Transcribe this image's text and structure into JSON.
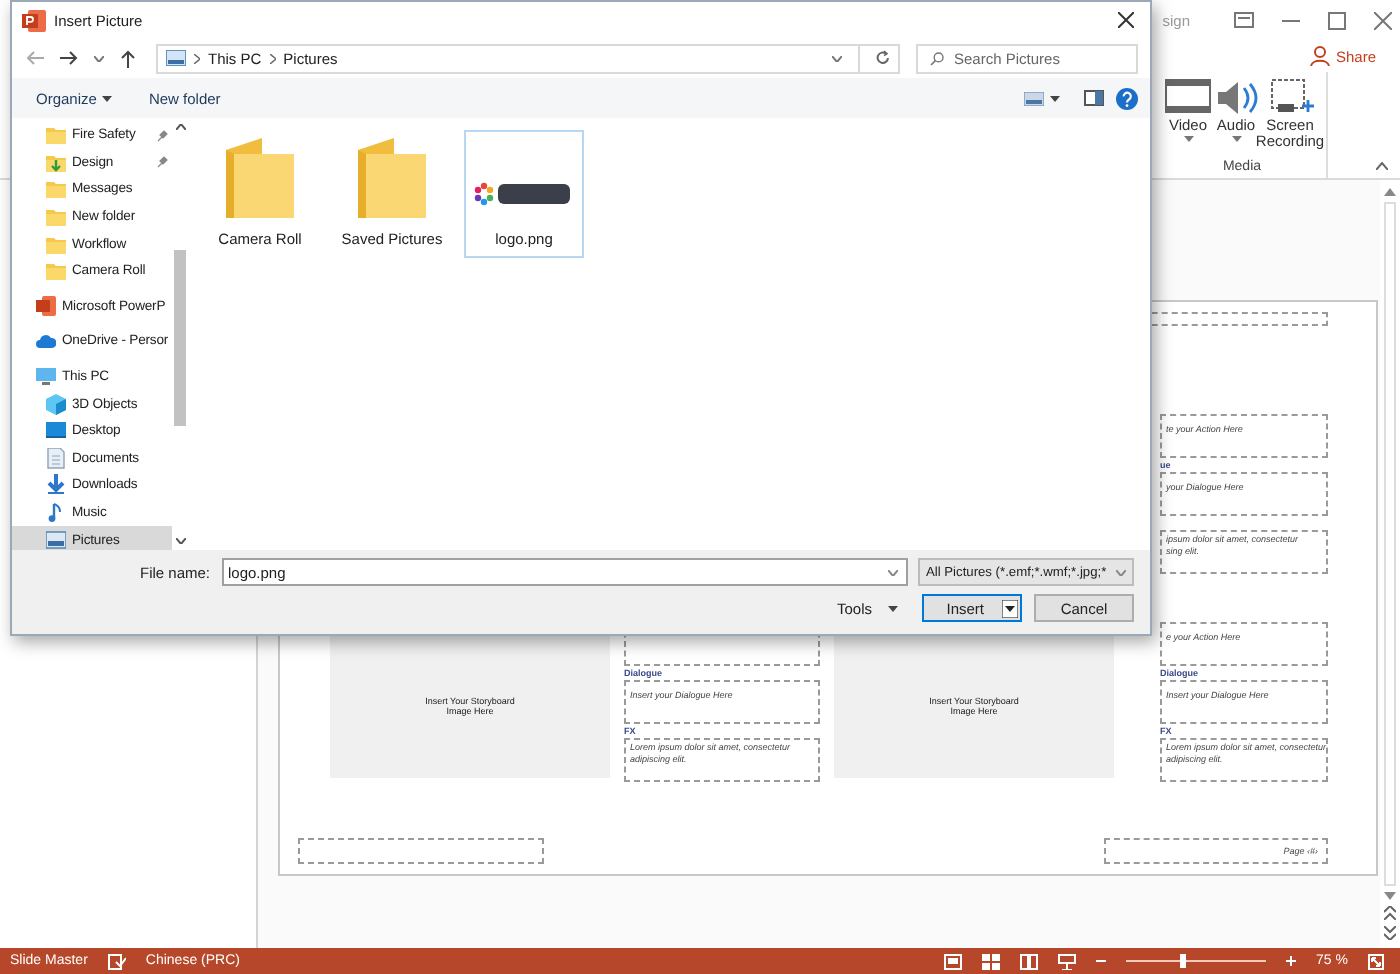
{
  "app": {
    "title_fragment": "sign",
    "share": "Share",
    "ribbon": {
      "buttons": [
        {
          "kind": "video",
          "label": "Video",
          "has_menu": true
        },
        {
          "kind": "audio",
          "label": "Audio",
          "has_menu": true
        },
        {
          "kind": "screen_recording",
          "label": "Screen Recording",
          "has_menu": false
        }
      ],
      "group": "Media"
    }
  },
  "dialog": {
    "title": "Insert Picture",
    "path": [
      "This PC",
      "Pictures"
    ],
    "search_placeholder": "Search Pictures",
    "toolbar": [
      "Organize",
      "New folder"
    ],
    "sidebar": [
      {
        "kind": "quick_access",
        "items": [
          {
            "label": "Fire Safety",
            "kind": "folder",
            "pinned": true,
            "selected": false
          },
          {
            "label": "Design",
            "kind": "download_folder",
            "pinned": true,
            "selected": false
          },
          {
            "label": "Messages",
            "kind": "folder",
            "pinned": false,
            "selected": false
          },
          {
            "label": "New folder",
            "kind": "folder",
            "pinned": false,
            "selected": false
          },
          {
            "label": "Workflow",
            "kind": "folder",
            "pinned": false,
            "selected": false
          },
          {
            "label": "Camera Roll",
            "kind": "folder",
            "pinned": false,
            "selected": false
          }
        ]
      },
      {
        "kind": "locations",
        "items": [
          {
            "label": "Microsoft PowerP",
            "kind": "powerpoint",
            "pinned": false,
            "selected": false
          }
        ]
      },
      {
        "kind": "locations",
        "items": [
          {
            "label": "OneDrive - Persor",
            "kind": "cloud",
            "pinned": false,
            "selected": false
          }
        ]
      },
      {
        "kind": "locations",
        "items": [
          {
            "label": "This PC",
            "kind": "computer",
            "pinned": false,
            "selected": false,
            "children": [
              {
                "label": "3D Objects",
                "kind": "cube",
                "pinned": false,
                "selected": false
              },
              {
                "label": "Desktop",
                "kind": "desktop",
                "pinned": false,
                "selected": false
              },
              {
                "label": "Documents",
                "kind": "document",
                "pinned": false,
                "selected": false
              },
              {
                "label": "Downloads",
                "kind": "download",
                "pinned": false,
                "selected": false
              },
              {
                "label": "Music",
                "kind": "music",
                "pinned": false,
                "selected": false
              },
              {
                "label": "Pictures",
                "kind": "pictures",
                "pinned": false,
                "selected": true
              }
            ]
          }
        ]
      }
    ],
    "files": [
      {
        "name": "Camera Roll",
        "kind": "folder",
        "selected": false
      },
      {
        "name": "Saved Pictures",
        "kind": "folder",
        "selected": false
      },
      {
        "name": "logo.png",
        "kind": "picture",
        "selected": true
      }
    ],
    "file_name": {
      "label": "File name:",
      "value": "logo.png"
    },
    "filter": "All Pictures (*.emf;*.wmf;*.jpg;*",
    "tools": "Tools",
    "buttons": [
      {
        "label": "Insert",
        "kind": "split"
      },
      {
        "label": "Cancel",
        "kind": "plain"
      }
    ]
  },
  "slide": {
    "frames": [
      {
        "fields": [
          {
            "kind": "box",
            "text": "te your Action Here"
          },
          {
            "kind": "box",
            "label": "ue",
            "text": "your Dialogue Here"
          },
          {
            "kind": "box",
            "text": "ipsum dolor sit amet, consectetur\nsing elit."
          }
        ]
      },
      {
        "image_text": "Insert Your Storyboard\nImage Here",
        "fields": [
          {
            "kind": "box"
          },
          {
            "kind": "box",
            "label": "Dialogue",
            "text": "Insert your Dialogue Here"
          },
          {
            "kind": "box",
            "label": "FX",
            "text": "Lorem ipsum dolor sit amet, consectetur\nadipiscing elit."
          }
        ]
      },
      {
        "image_text": "Insert Your Storyboard\nImage Here",
        "fields": [
          {
            "kind": "box",
            "text": "e your Action Here"
          },
          {
            "kind": "box",
            "label": "Dialogue",
            "text": "Insert your Dialogue Here"
          },
          {
            "kind": "box",
            "label": "FX",
            "text": "Lorem ipsum dolor sit amet, consectetur\nadipiscing elit."
          }
        ]
      }
    ],
    "footer": "Page ‹#›"
  },
  "status_bar": {
    "view": "Slide Master",
    "language": "Chinese (PRC)",
    "zoom": "75 %",
    "zoom_slider": {
      "level": 0.4
    }
  }
}
